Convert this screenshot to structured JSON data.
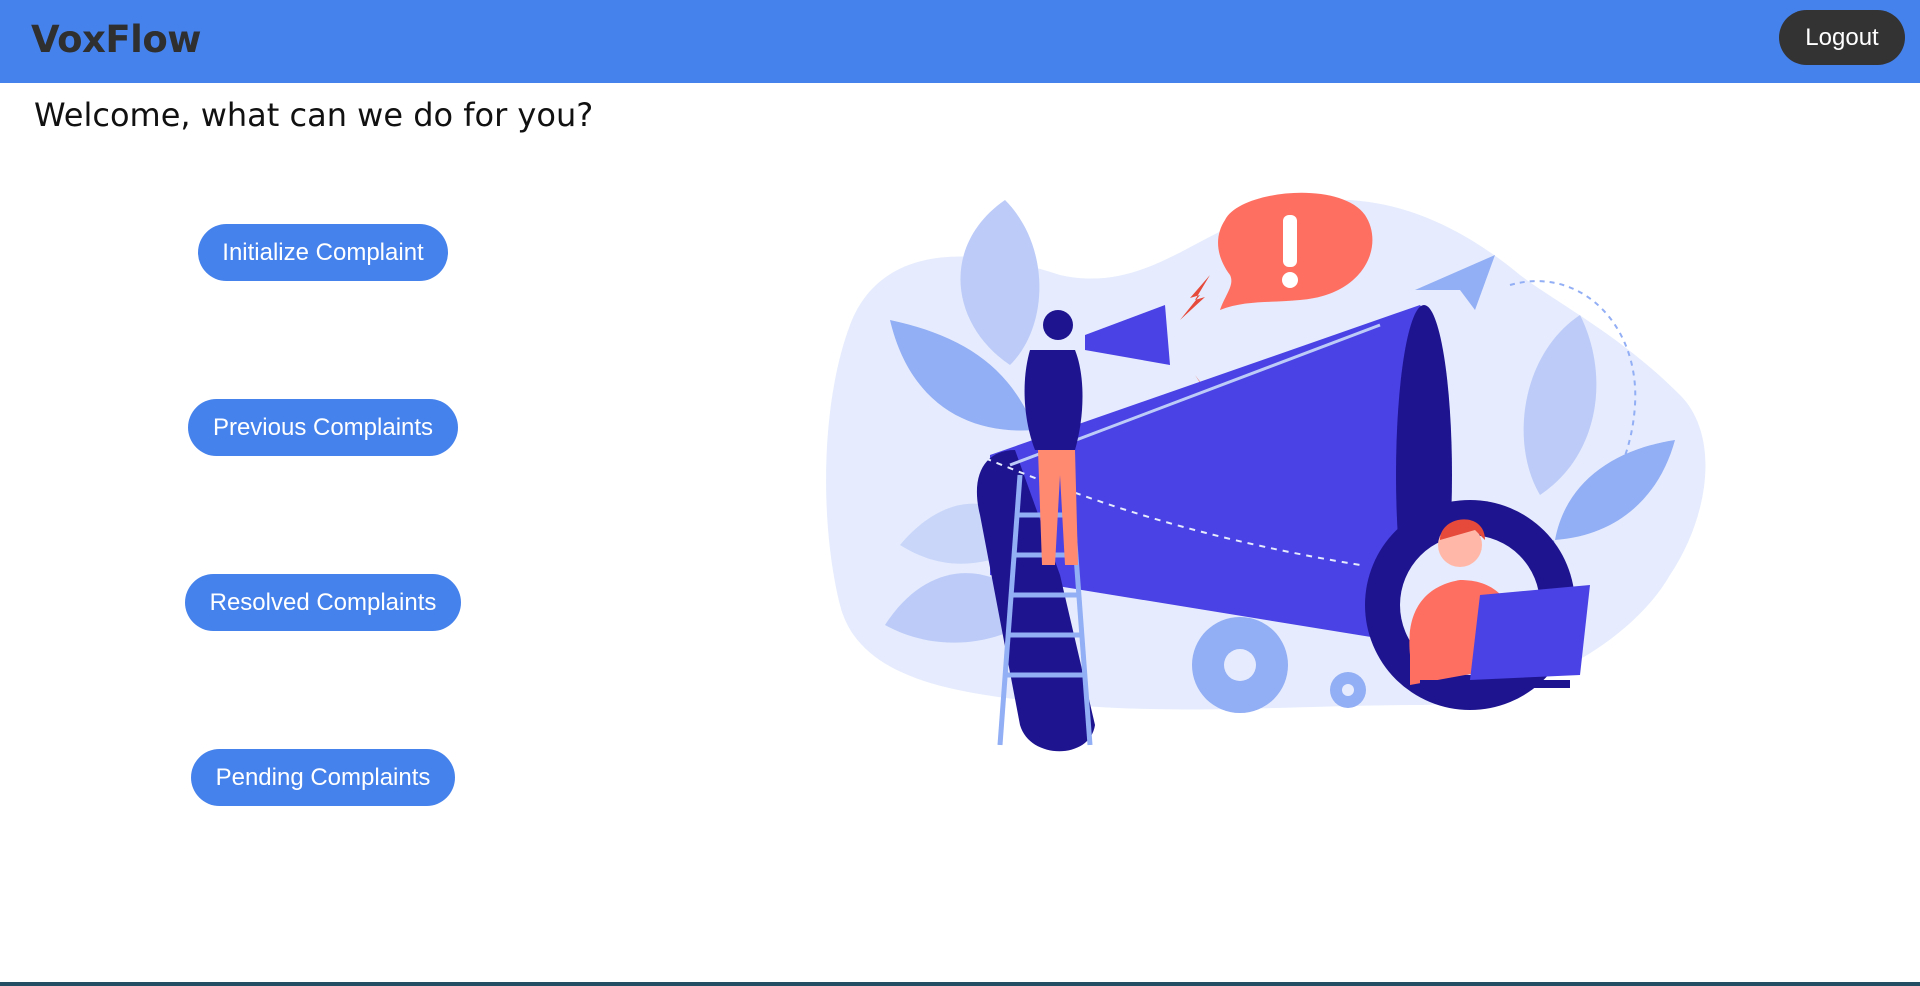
{
  "app": {
    "brand": "VoxFlow",
    "logout_label": "Logout"
  },
  "main": {
    "welcome": "Welcome, what can we do for you?",
    "actions": [
      {
        "label": "Initialize Complaint"
      },
      {
        "label": "Previous Complaints"
      },
      {
        "label": "Resolved Complaints"
      },
      {
        "label": "Pending Complaints"
      }
    ]
  },
  "illustration": {
    "icon": "megaphone-announcement-illustration"
  },
  "colors": {
    "navbar": "#4682eb",
    "button": "#4682eb",
    "logout": "#333333",
    "accent_red": "#ff6f61",
    "megaphone": "#4a42e4"
  }
}
